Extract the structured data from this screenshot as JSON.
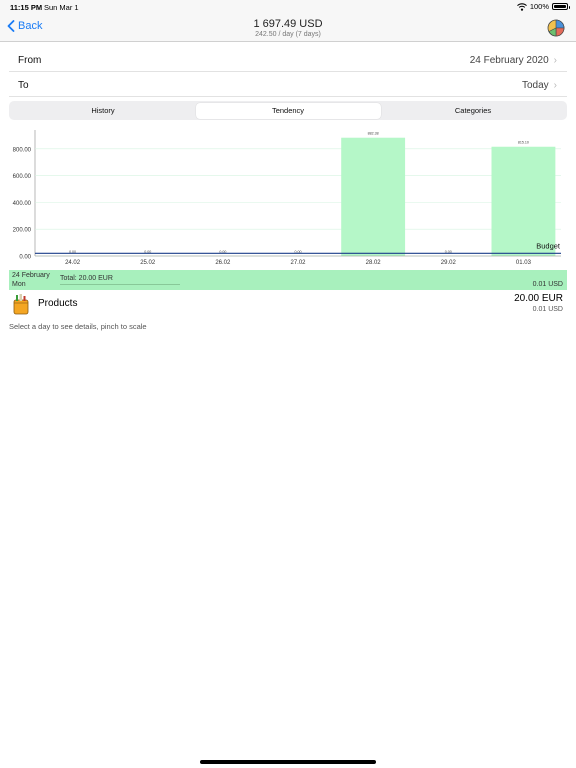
{
  "status": {
    "time": "11:15 PM",
    "date": "Sun Mar 1",
    "battery": "100%"
  },
  "nav": {
    "back_label": "Back",
    "title": "1 697.49 USD",
    "subtitle": "242.50 / day (7 days)",
    "icon": "pie-chart-icon"
  },
  "from": {
    "label": "From",
    "value": "24 February 2020"
  },
  "to": {
    "label": "To",
    "value": "Today"
  },
  "tabs": [
    {
      "label": "History",
      "active": false
    },
    {
      "label": "Tendency",
      "active": true
    },
    {
      "label": "Categories",
      "active": false
    }
  ],
  "chart_data": {
    "type": "bar",
    "categories": [
      "24.02",
      "25.02",
      "26.02",
      "27.02",
      "28.02",
      "29.02",
      "01.03"
    ],
    "values": [
      0,
      0,
      0,
      0,
      882.38,
      0,
      815.1
    ],
    "value_labels": [
      "0.00",
      "0.00",
      "0.00",
      "0.00",
      "882.38",
      "0.00",
      "815.10"
    ],
    "ylim": [
      0,
      940
    ],
    "yticks": [
      0,
      200,
      400,
      600,
      800
    ],
    "ytick_labels": [
      "0.00",
      "200.00",
      "400.00",
      "600.00",
      "800.00"
    ],
    "budget_label": "Budget",
    "budget_value": 20,
    "grid": true,
    "bar_color": "#b5f7c8",
    "budget_color": "#1c3f8a"
  },
  "detail": {
    "date": "24 February",
    "weekday": "Mon",
    "total": "Total: 20.00 EUR",
    "amount_usd": "0.01 USD"
  },
  "product": {
    "name": "Products",
    "amount": "20.00 EUR",
    "amount_usd": "0.01 USD",
    "icon": "shopping-bag-icon"
  },
  "hint": "Select a day to see details, pinch to scale",
  "colors": {
    "accent": "#1a7cf5",
    "highlight": "#a8f0bd"
  }
}
